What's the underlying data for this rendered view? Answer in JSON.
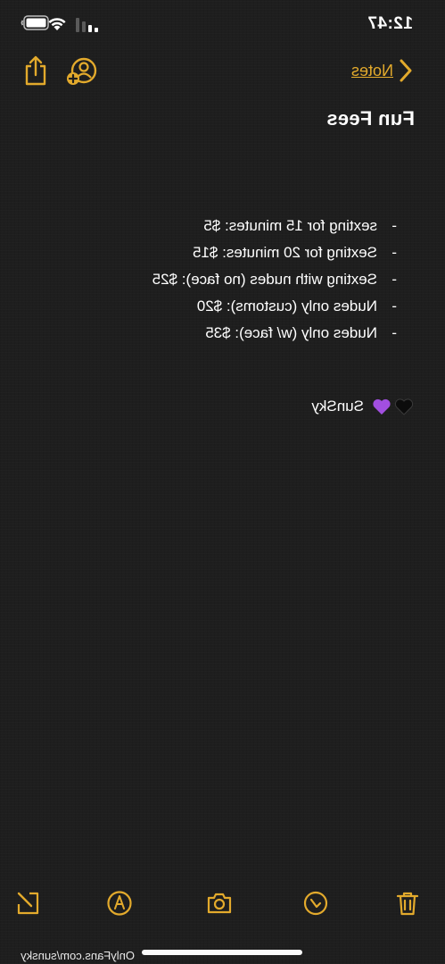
{
  "status_bar": {
    "time": "12:47",
    "signal_bars": 2,
    "wifi_icon": "wifi-icon",
    "battery_icon": "battery-icon"
  },
  "nav": {
    "back_label": "Notes",
    "back_icon": "chevron-left-icon",
    "add_person_icon": "person-add-icon",
    "share_icon": "share-icon"
  },
  "note": {
    "title": "Fun Fees",
    "items": [
      "sexting for 15 minutes: $5",
      "Sexting for 20 minutes: $15",
      "Sexting with nudes (no face): $25",
      "Nudes only (customs): $20",
      "Nudes only (w/ face): $35"
    ],
    "signature_emoji": [
      "black-heart-icon",
      "purple-heart-icon"
    ],
    "signature_text": "SunSky"
  },
  "toolbar": {
    "items": [
      "delete-icon",
      "checklist-icon",
      "camera-icon",
      "markup-icon",
      "compose-icon"
    ]
  },
  "watermark": "OnlyFans.com/sunsky",
  "colors": {
    "accent": "#e3aa2c",
    "background": "#1e1e1e",
    "text": "#ffffff",
    "purple_heart": "#a24fe0"
  }
}
